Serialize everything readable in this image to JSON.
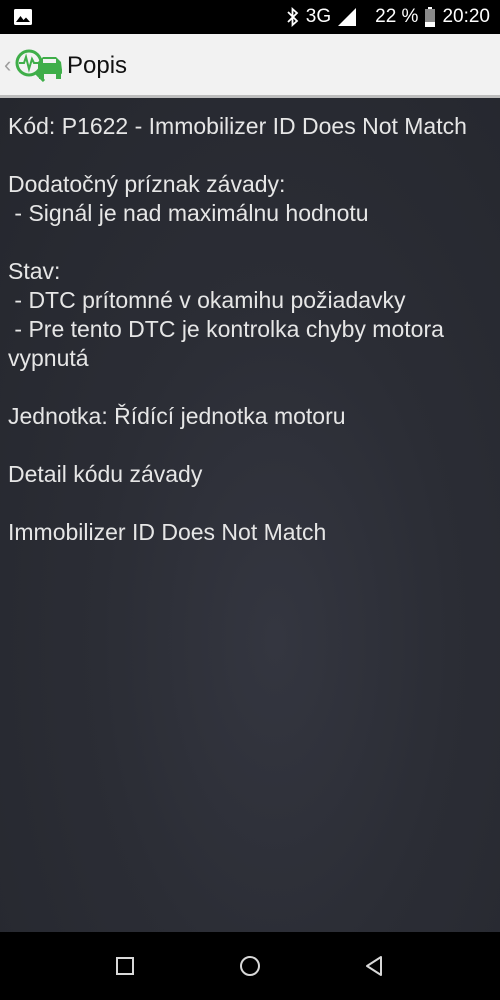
{
  "status_bar": {
    "network": "3G",
    "battery": "22 %",
    "time": "20:20"
  },
  "app_bar": {
    "title": "Popis"
  },
  "details": {
    "code_line": "Kód: P1622 - Immobilizer ID Does Not Match",
    "additional_symptom_label": "Dodatočný príznak závady:",
    "additional_symptom_value": " - Signál je nad maximálnu hodnotu",
    "status_label": "Stav:",
    "status_items": [
      " - DTC prítomné v okamihu požiadavky",
      " - Pre tento DTC je kontrolka chyby motora vypnutá"
    ],
    "unit_line": "Jednotka: Řídící jednotka motoru",
    "detail_heading": "Detail kódu závady",
    "detail_text": "Immobilizer ID Does Not Match"
  },
  "colors": {
    "content_bg": "#2b2d35",
    "app_bar_bg": "#f2f2f2",
    "logo_green": "#3fae49"
  },
  "icons": {
    "status_left": "gallery-icon",
    "bluetooth": "bluetooth-icon",
    "signal": "signal-icon",
    "battery": "battery-icon",
    "logo": "car-diagnostic-logo-icon",
    "nav": [
      "recents-icon",
      "home-icon",
      "back-icon"
    ]
  }
}
